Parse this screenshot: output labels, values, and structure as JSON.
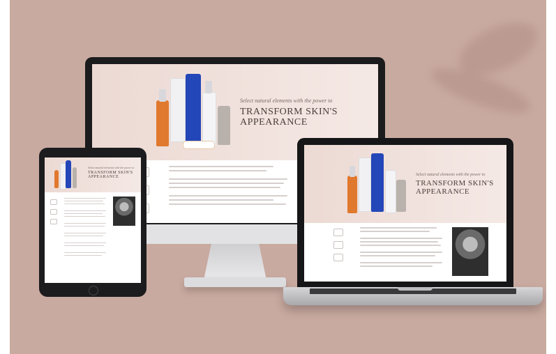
{
  "hero": {
    "tagline": "Select natural elements with the power to",
    "headline_line1": "TRANSFORM SKIN'S",
    "headline_line2": "APPEARANCE"
  },
  "devices": [
    "desktop-monitor",
    "tablet",
    "laptop"
  ],
  "colors": {
    "backdrop": "#c9aaa0",
    "hero_pink": "#ecd9d3",
    "device_frame": "#1b1b1d",
    "bottle_orange": "#e0792e",
    "bottle_blue": "#2346b8"
  }
}
